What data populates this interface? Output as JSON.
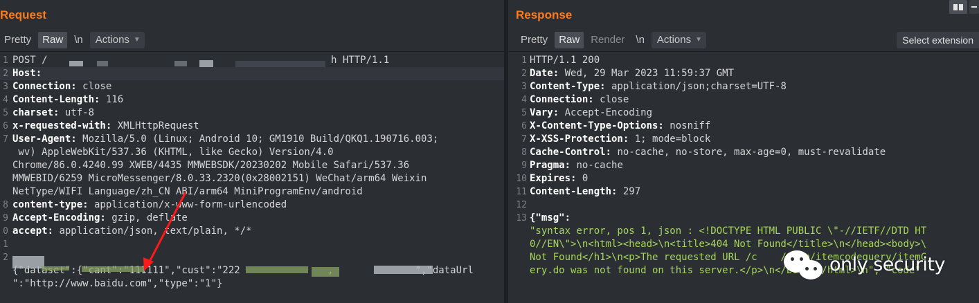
{
  "request": {
    "title": "Request",
    "tabs": [
      {
        "label": "Pretty",
        "active": false
      },
      {
        "label": "Raw",
        "active": true
      },
      {
        "label": "\\n",
        "active": false
      }
    ],
    "actions_label": "Actions",
    "lines": [
      {
        "n": "1",
        "text": "POST /",
        "kind": "plain",
        "suffix": "h HTTP/1.1"
      },
      {
        "n": "2",
        "key": "Host:",
        "value": ""
      },
      {
        "n": "3",
        "key": "Connection:",
        "value": " close"
      },
      {
        "n": "4",
        "key": "Content-Length:",
        "value": " 116"
      },
      {
        "n": "5",
        "key": "charset:",
        "value": " utf-8"
      },
      {
        "n": "6",
        "key": "x-requested-with:",
        "value": " XMLHttpRequest"
      },
      {
        "n": "7",
        "key": "User-Agent:",
        "value": " Mozilla/5.0 (Linux; Android 10; GM1910 Build/QKQ1.190716.003;"
      },
      {
        "n": "",
        "text": " wv) AppleWebKit/537.36 (KHTML, like Gecko) Version/4.0"
      },
      {
        "n": "",
        "text": "Chrome/86.0.4240.99 XWEB/4435 MMWEBSDK/20230202 Mobile Safari/537.36"
      },
      {
        "n": "",
        "text": "MMWEBID/6259 MicroMessenger/8.0.33.2320(0x28002151) WeChat/arm64 Weixin"
      },
      {
        "n": "",
        "text": "NetType/WIFI Language/zh_CN ABI/arm64 MiniProgramEnv/android"
      },
      {
        "n": "8",
        "key": "content-type:",
        "value": " application/x-www-form-urlencoded"
      },
      {
        "n": "9",
        "key": "Accept-Encoding:",
        "value": " gzip, deflate"
      },
      {
        "n": "0",
        "key": "accept:",
        "value": " application/json, text/plain, */*"
      },
      {
        "n": "1",
        "text": ""
      },
      {
        "n": "2",
        "text": ""
      },
      {
        "n": "",
        "text": "{\"dataset\":{\"cant\":\"111111\",\"cust\":\"222               ,              \",\"dataUrl"
      },
      {
        "n": "",
        "text": "\":\"http://www.baidu.com\",\"type\":\"1\"}"
      }
    ]
  },
  "response": {
    "title": "Response",
    "tabs": [
      {
        "label": "Pretty",
        "active": false
      },
      {
        "label": "Raw",
        "active": true
      },
      {
        "label": "Render",
        "active": false,
        "muted": true
      },
      {
        "label": "\\n",
        "active": false
      }
    ],
    "actions_label": "Actions",
    "select_extension": "Select extension",
    "lines": [
      {
        "n": "1",
        "text": "HTTP/1.1 200"
      },
      {
        "n": "2",
        "key": "Date:",
        "value": " Wed, 29 Mar 2023 11:59:37 GMT"
      },
      {
        "n": "3",
        "key": "Content-Type:",
        "value": " application/json;charset=UTF-8"
      },
      {
        "n": "4",
        "key": "Connection:",
        "value": " close"
      },
      {
        "n": "5",
        "key": "Vary:",
        "value": " Accept-Encoding"
      },
      {
        "n": "6",
        "key": "X-Content-Type-Options:",
        "value": " nosniff"
      },
      {
        "n": "7",
        "key": "X-XSS-Protection:",
        "value": " 1; mode=block"
      },
      {
        "n": "8",
        "key": "Cache-Control:",
        "value": " no-cache, no-store, max-age=0, must-revalidate"
      },
      {
        "n": "9",
        "key": "Pragma:",
        "value": " no-cache"
      },
      {
        "n": "10",
        "key": "Expires:",
        "value": " 0"
      },
      {
        "n": "11",
        "key": "Content-Length:",
        "value": " 297"
      },
      {
        "n": "12",
        "text": ""
      },
      {
        "n": "13",
        "key": "{\"msg\":",
        "value": ""
      },
      {
        "n": "",
        "text": "\"syntax error, pos 1, json : <!DOCTYPE HTML PUBLIC \\\"-//IETF//DTD HT",
        "green": true
      },
      {
        "n": "",
        "text": "0//EN\\\">\\n<html><head>\\n<title>404 Not Found</title>\\n</head><body>\\",
        "green": true
      },
      {
        "n": "",
        "text": "Not Found</h1>\\n<p>The requested URL /c    /comm/itemcodequery/itemC",
        "green": true
      },
      {
        "n": "",
        "text": "ery.do was not found on this server.</p>\\n</body></html>\\n\", \"code\"",
        "green": true
      }
    ]
  },
  "watermark": {
    "text": "only security"
  },
  "colors": {
    "accent": "#ff7a1a",
    "background": "#2b2f34",
    "string": "#a7d65a",
    "arrow": "#ff1a1a"
  }
}
